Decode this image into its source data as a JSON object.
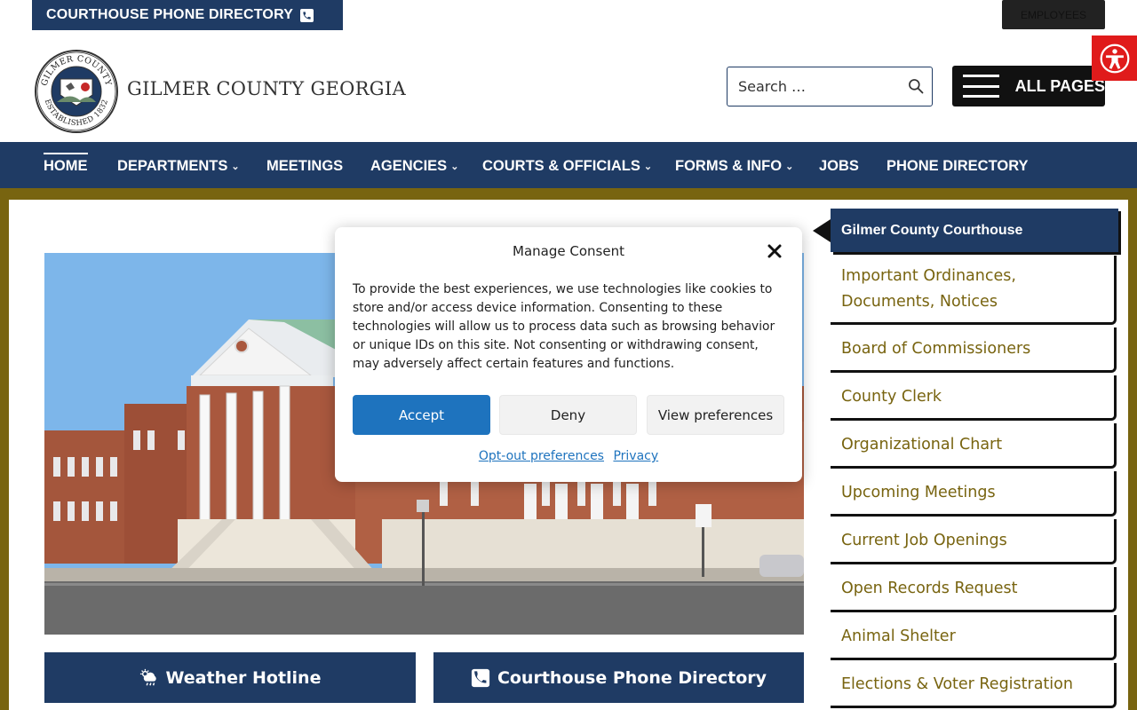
{
  "topbar": {
    "directory_label": "COURTHOUSE PHONE DIRECTORY",
    "employees_label": "EMPLOYEES"
  },
  "header": {
    "site_title": "GILMER COUNTY GEORGIA",
    "logo_text_top": "GILMER COUNTY",
    "logo_text_bottom": "ESTABLISHED 1832",
    "search_placeholder": "Search …",
    "all_pages_label": "ALL PAGES"
  },
  "nav": {
    "items": [
      {
        "label": "HOME",
        "has_dropdown": false,
        "active": true
      },
      {
        "label": "DEPARTMENTS",
        "has_dropdown": true
      },
      {
        "label": "MEETINGS",
        "has_dropdown": false
      },
      {
        "label": "AGENCIES",
        "has_dropdown": true
      },
      {
        "label": "COURTS & OFFICIALS",
        "has_dropdown": true
      },
      {
        "label": "FORMS & INFO",
        "has_dropdown": true
      },
      {
        "label": "JOBS",
        "has_dropdown": false
      },
      {
        "label": "PHONE DIRECTORY",
        "has_dropdown": false
      }
    ]
  },
  "main": {
    "weather_button": "Weather Hotline",
    "directory_button": "Courthouse Phone Directory"
  },
  "sidebar": {
    "heading": "Gilmer County Courthouse",
    "items": [
      "Important Ordinances,",
      "Documents, Notices",
      "Board of Commissioners",
      "County Clerk",
      "Organizational Chart",
      "Upcoming Meetings",
      "Current Job Openings",
      "Open Records Request",
      "Animal Shelter",
      "Elections & Voter Registration"
    ]
  },
  "consent": {
    "title": "Manage Consent",
    "body": "To provide the best experiences, we use technologies like cookies to store and/or access device information. Consenting to these technologies will allow us to process data such as browsing behavior or unique IDs on this site. Not consenting or withdrawing consent, may adversely affect certain features and functions.",
    "accept_label": "Accept",
    "deny_label": "Deny",
    "view_label": "View preferences",
    "optout_link": "Opt-out preferences",
    "privacy_link": "Privacy"
  },
  "colors": {
    "navy": "#1f3b64",
    "gold": "#786410",
    "accept_blue": "#1e73be",
    "accessibility_red": "#e01b1b"
  }
}
